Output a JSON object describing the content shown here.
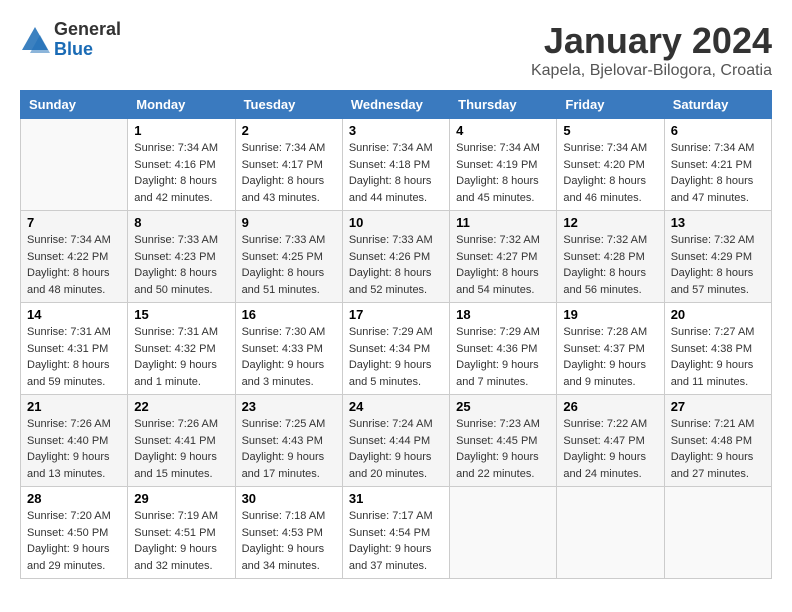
{
  "logo": {
    "general": "General",
    "blue": "Blue"
  },
  "title": {
    "month": "January 2024",
    "location": "Kapela, Bjelovar-Bilogora, Croatia"
  },
  "headers": [
    "Sunday",
    "Monday",
    "Tuesday",
    "Wednesday",
    "Thursday",
    "Friday",
    "Saturday"
  ],
  "weeks": [
    [
      {
        "day": "",
        "sunrise": "",
        "sunset": "",
        "daylight": ""
      },
      {
        "day": "1",
        "sunrise": "Sunrise: 7:34 AM",
        "sunset": "Sunset: 4:16 PM",
        "daylight": "Daylight: 8 hours and 42 minutes."
      },
      {
        "day": "2",
        "sunrise": "Sunrise: 7:34 AM",
        "sunset": "Sunset: 4:17 PM",
        "daylight": "Daylight: 8 hours and 43 minutes."
      },
      {
        "day": "3",
        "sunrise": "Sunrise: 7:34 AM",
        "sunset": "Sunset: 4:18 PM",
        "daylight": "Daylight: 8 hours and 44 minutes."
      },
      {
        "day": "4",
        "sunrise": "Sunrise: 7:34 AM",
        "sunset": "Sunset: 4:19 PM",
        "daylight": "Daylight: 8 hours and 45 minutes."
      },
      {
        "day": "5",
        "sunrise": "Sunrise: 7:34 AM",
        "sunset": "Sunset: 4:20 PM",
        "daylight": "Daylight: 8 hours and 46 minutes."
      },
      {
        "day": "6",
        "sunrise": "Sunrise: 7:34 AM",
        "sunset": "Sunset: 4:21 PM",
        "daylight": "Daylight: 8 hours and 47 minutes."
      }
    ],
    [
      {
        "day": "7",
        "sunrise": "Sunrise: 7:34 AM",
        "sunset": "Sunset: 4:22 PM",
        "daylight": "Daylight: 8 hours and 48 minutes."
      },
      {
        "day": "8",
        "sunrise": "Sunrise: 7:33 AM",
        "sunset": "Sunset: 4:23 PM",
        "daylight": "Daylight: 8 hours and 50 minutes."
      },
      {
        "day": "9",
        "sunrise": "Sunrise: 7:33 AM",
        "sunset": "Sunset: 4:25 PM",
        "daylight": "Daylight: 8 hours and 51 minutes."
      },
      {
        "day": "10",
        "sunrise": "Sunrise: 7:33 AM",
        "sunset": "Sunset: 4:26 PM",
        "daylight": "Daylight: 8 hours and 52 minutes."
      },
      {
        "day": "11",
        "sunrise": "Sunrise: 7:32 AM",
        "sunset": "Sunset: 4:27 PM",
        "daylight": "Daylight: 8 hours and 54 minutes."
      },
      {
        "day": "12",
        "sunrise": "Sunrise: 7:32 AM",
        "sunset": "Sunset: 4:28 PM",
        "daylight": "Daylight: 8 hours and 56 minutes."
      },
      {
        "day": "13",
        "sunrise": "Sunrise: 7:32 AM",
        "sunset": "Sunset: 4:29 PM",
        "daylight": "Daylight: 8 hours and 57 minutes."
      }
    ],
    [
      {
        "day": "14",
        "sunrise": "Sunrise: 7:31 AM",
        "sunset": "Sunset: 4:31 PM",
        "daylight": "Daylight: 8 hours and 59 minutes."
      },
      {
        "day": "15",
        "sunrise": "Sunrise: 7:31 AM",
        "sunset": "Sunset: 4:32 PM",
        "daylight": "Daylight: 9 hours and 1 minute."
      },
      {
        "day": "16",
        "sunrise": "Sunrise: 7:30 AM",
        "sunset": "Sunset: 4:33 PM",
        "daylight": "Daylight: 9 hours and 3 minutes."
      },
      {
        "day": "17",
        "sunrise": "Sunrise: 7:29 AM",
        "sunset": "Sunset: 4:34 PM",
        "daylight": "Daylight: 9 hours and 5 minutes."
      },
      {
        "day": "18",
        "sunrise": "Sunrise: 7:29 AM",
        "sunset": "Sunset: 4:36 PM",
        "daylight": "Daylight: 9 hours and 7 minutes."
      },
      {
        "day": "19",
        "sunrise": "Sunrise: 7:28 AM",
        "sunset": "Sunset: 4:37 PM",
        "daylight": "Daylight: 9 hours and 9 minutes."
      },
      {
        "day": "20",
        "sunrise": "Sunrise: 7:27 AM",
        "sunset": "Sunset: 4:38 PM",
        "daylight": "Daylight: 9 hours and 11 minutes."
      }
    ],
    [
      {
        "day": "21",
        "sunrise": "Sunrise: 7:26 AM",
        "sunset": "Sunset: 4:40 PM",
        "daylight": "Daylight: 9 hours and 13 minutes."
      },
      {
        "day": "22",
        "sunrise": "Sunrise: 7:26 AM",
        "sunset": "Sunset: 4:41 PM",
        "daylight": "Daylight: 9 hours and 15 minutes."
      },
      {
        "day": "23",
        "sunrise": "Sunrise: 7:25 AM",
        "sunset": "Sunset: 4:43 PM",
        "daylight": "Daylight: 9 hours and 17 minutes."
      },
      {
        "day": "24",
        "sunrise": "Sunrise: 7:24 AM",
        "sunset": "Sunset: 4:44 PM",
        "daylight": "Daylight: 9 hours and 20 minutes."
      },
      {
        "day": "25",
        "sunrise": "Sunrise: 7:23 AM",
        "sunset": "Sunset: 4:45 PM",
        "daylight": "Daylight: 9 hours and 22 minutes."
      },
      {
        "day": "26",
        "sunrise": "Sunrise: 7:22 AM",
        "sunset": "Sunset: 4:47 PM",
        "daylight": "Daylight: 9 hours and 24 minutes."
      },
      {
        "day": "27",
        "sunrise": "Sunrise: 7:21 AM",
        "sunset": "Sunset: 4:48 PM",
        "daylight": "Daylight: 9 hours and 27 minutes."
      }
    ],
    [
      {
        "day": "28",
        "sunrise": "Sunrise: 7:20 AM",
        "sunset": "Sunset: 4:50 PM",
        "daylight": "Daylight: 9 hours and 29 minutes."
      },
      {
        "day": "29",
        "sunrise": "Sunrise: 7:19 AM",
        "sunset": "Sunset: 4:51 PM",
        "daylight": "Daylight: 9 hours and 32 minutes."
      },
      {
        "day": "30",
        "sunrise": "Sunrise: 7:18 AM",
        "sunset": "Sunset: 4:53 PM",
        "daylight": "Daylight: 9 hours and 34 minutes."
      },
      {
        "day": "31",
        "sunrise": "Sunrise: 7:17 AM",
        "sunset": "Sunset: 4:54 PM",
        "daylight": "Daylight: 9 hours and 37 minutes."
      },
      {
        "day": "",
        "sunrise": "",
        "sunset": "",
        "daylight": ""
      },
      {
        "day": "",
        "sunrise": "",
        "sunset": "",
        "daylight": ""
      },
      {
        "day": "",
        "sunrise": "",
        "sunset": "",
        "daylight": ""
      }
    ]
  ]
}
